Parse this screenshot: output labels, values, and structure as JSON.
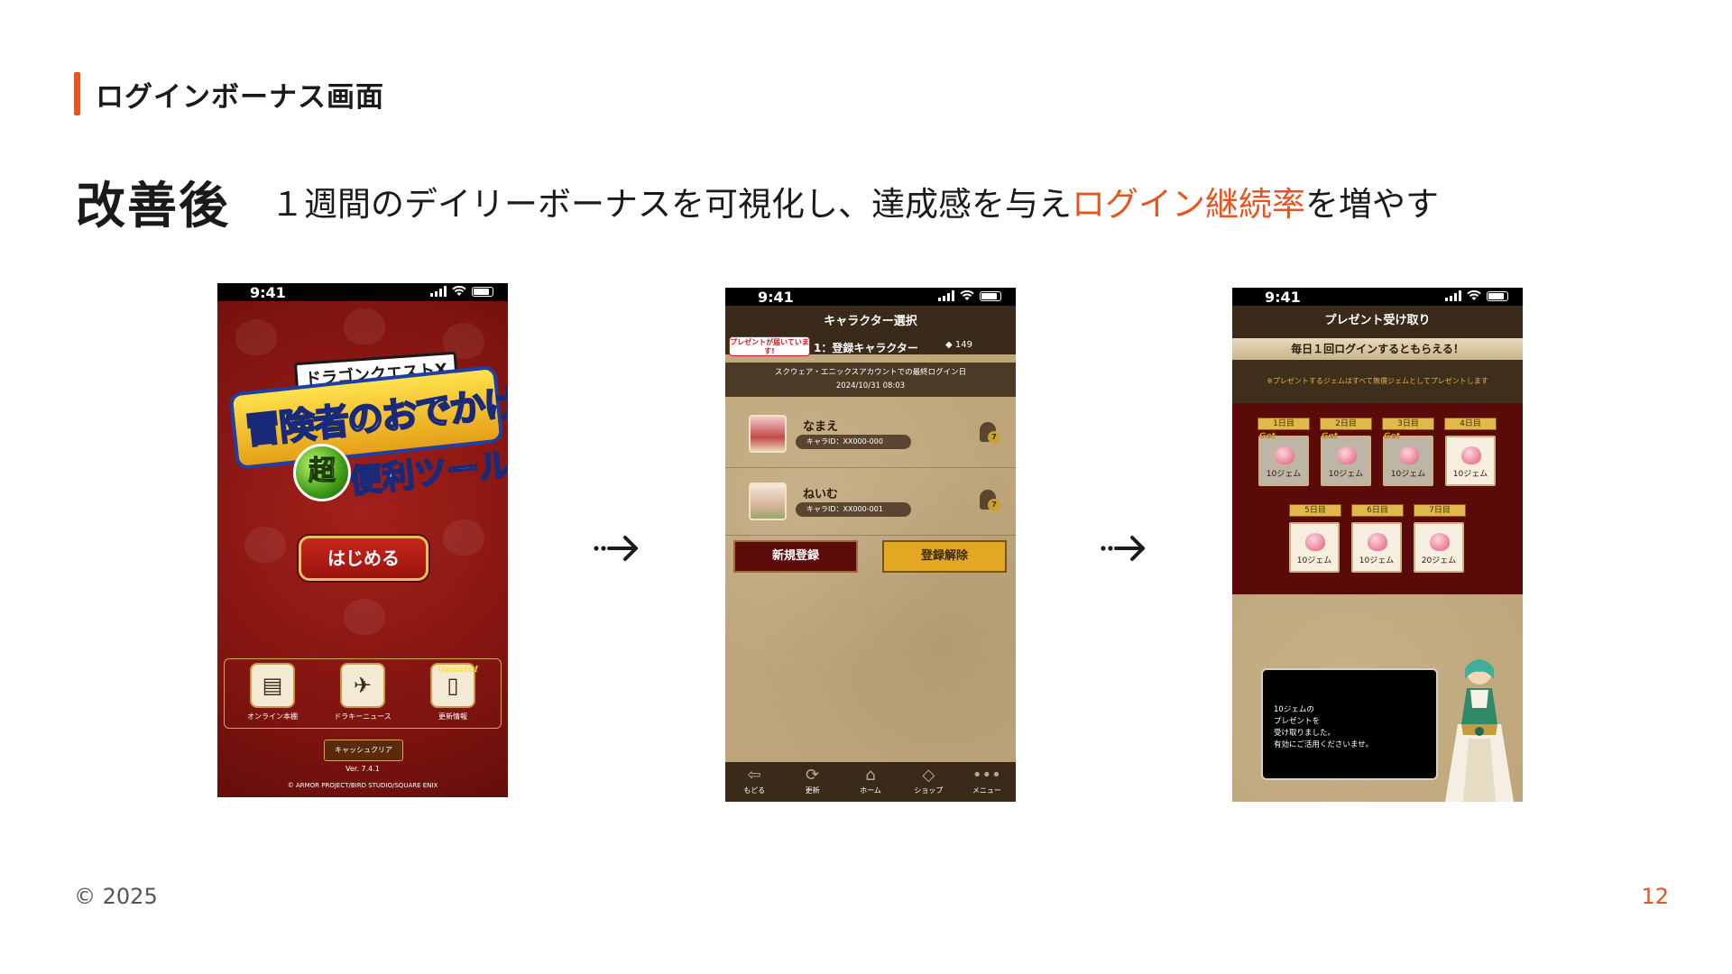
{
  "slide": {
    "section_title": "ログインボーナス画面",
    "heading": "改善後",
    "subtitle_pre": "１週間のデイリーボーナスを可視化し、達成感を与え",
    "subtitle_highlight": "ログイン継続率",
    "subtitle_post": "を増やす",
    "footer_copyright": "© 2025",
    "page_number": "12",
    "accent_color": "#e8541e"
  },
  "phone1": {
    "time": "9:41",
    "logo_top": "ドラゴンクエストX",
    "logo_main": "冒険者のおでかけ",
    "logo_sub": "便利ツール",
    "logo_badge": "超",
    "start_button": "はじめる",
    "menu": [
      {
        "icon": "book-icon",
        "glyph": "▤",
        "label": "オンライン本棚"
      },
      {
        "icon": "dracky-news-icon",
        "glyph": "✈",
        "label": "ドラキーニュース"
      },
      {
        "icon": "phone-update-icon",
        "glyph": "▯",
        "label": "更新情報"
      }
    ],
    "update_badge": "Update!",
    "cache_button": "キャッシュクリア",
    "version": "Ver. 7.4.1",
    "copyright": "© ARMOR PROJECT/BIRD STUDIO/SQUARE ENIX"
  },
  "phone2": {
    "time": "9:41",
    "title": "キャラクター選択",
    "present_notice": "プレゼントが届いています!",
    "slot_label": "1：登録キャラクター",
    "gem_count": "149",
    "last_login_label": "スクウェア・エニックスアカウントでの最終ログイン日",
    "last_login_date": "2024/10/31  08:03",
    "characters": [
      {
        "name": "なまえ",
        "id": "キャラID：XX000-000",
        "bell_count": "7"
      },
      {
        "name": "ねいむ",
        "id": "キャラID：XX000-001",
        "bell_count": "7"
      }
    ],
    "new_button": "新規登録",
    "delete_button": "登録解除",
    "nav": [
      {
        "icon": "back-icon",
        "glyph": "⇦",
        "label": "もどる"
      },
      {
        "icon": "refresh-icon",
        "glyph": "⟳",
        "label": "更新"
      },
      {
        "icon": "home-icon",
        "glyph": "⌂",
        "label": "ホーム"
      },
      {
        "icon": "shop-icon",
        "glyph": "◇",
        "label": "ショップ"
      },
      {
        "icon": "menu-icon",
        "glyph": "•••",
        "label": "メニュー"
      }
    ]
  },
  "phone3": {
    "time": "9:41",
    "title": "プレゼント受け取り",
    "banner": "毎日１回ログインするともらえる！",
    "note": "※プレゼントするジェムはすべて無償ジェムとしてプレゼントします",
    "days": [
      {
        "label": "1日目",
        "amount": "10ジェム",
        "got": true
      },
      {
        "label": "2日目",
        "amount": "10ジェム",
        "got": true
      },
      {
        "label": "3日目",
        "amount": "10ジェム",
        "got": true
      },
      {
        "label": "4日目",
        "amount": "10ジェム",
        "got": false
      },
      {
        "label": "5日目",
        "amount": "10ジェム",
        "got": false
      },
      {
        "label": "6日目",
        "amount": "10ジェム",
        "got": false
      },
      {
        "label": "7日目",
        "amount": "20ジェム",
        "got": false
      }
    ],
    "get_tag": "Get",
    "message_lines": [
      "10ジェムの",
      "プレゼントを",
      "受け取りました。",
      "有効にご活用くださいませ。"
    ]
  }
}
